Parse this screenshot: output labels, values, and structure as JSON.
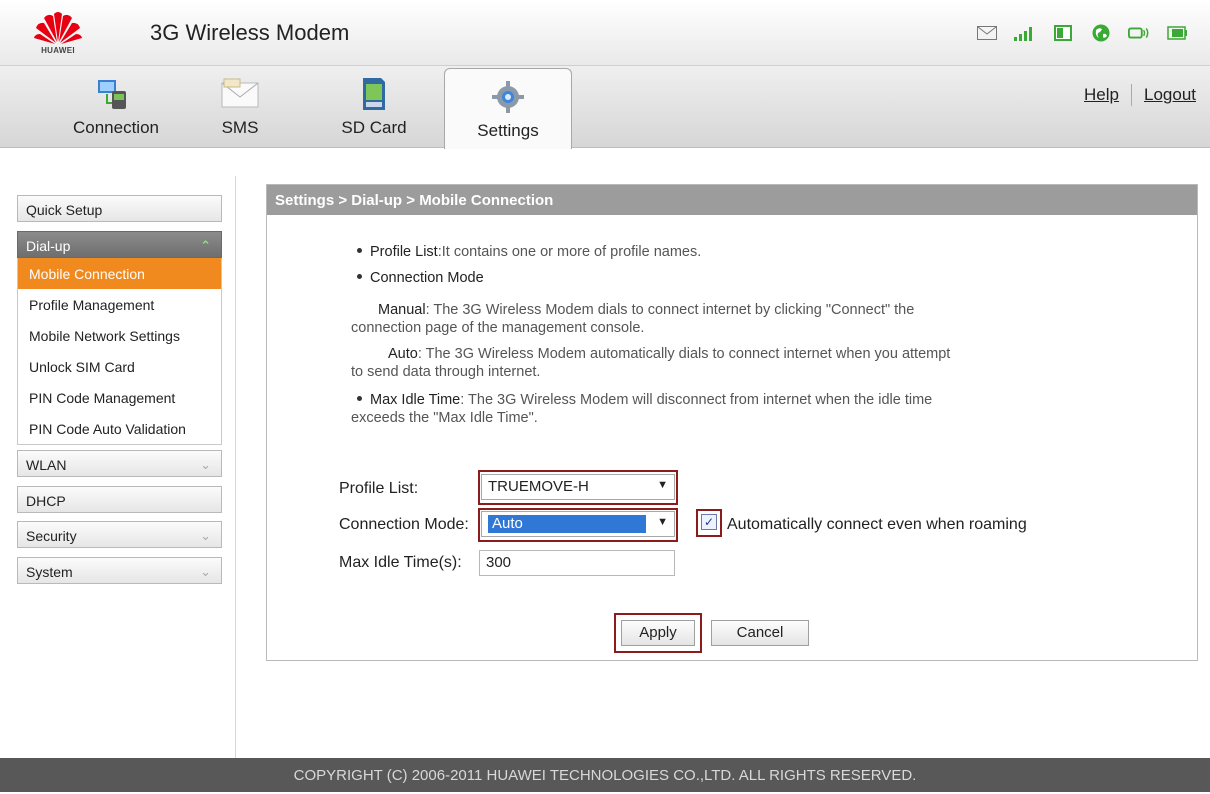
{
  "header": {
    "brand": "HUAWEI",
    "title": "3G Wireless Modem",
    "status_icons": [
      "envelope-icon",
      "signal-bars-icon",
      "sim-icon",
      "globe-icon",
      "wifi-router-icon",
      "battery-icon"
    ]
  },
  "tabs": [
    {
      "label": "Connection",
      "icon": "connection-icon",
      "active": false
    },
    {
      "label": "SMS",
      "icon": "envelope-icon",
      "active": false
    },
    {
      "label": "SD Card",
      "icon": "sd-card-icon",
      "active": false
    },
    {
      "label": "Settings",
      "icon": "gear-icon",
      "active": true
    }
  ],
  "top_links": {
    "help": "Help",
    "logout": "Logout"
  },
  "sidebar": {
    "quick_setup": "Quick Setup",
    "dialup": "Dial-up",
    "dialup_items": [
      "Mobile Connection",
      "Profile Management",
      "Mobile Network Settings",
      "Unlock SIM Card",
      "PIN Code Management",
      "PIN Code Auto Validation"
    ],
    "active_item": "Mobile Connection",
    "wlan": "WLAN",
    "dhcp": "DHCP",
    "security": "Security",
    "system": "System"
  },
  "panel": {
    "breadcrumb": "Settings > Dial-up > Mobile Connection",
    "help": {
      "profile_list_term": "Profile List",
      "profile_list_desc": ":It contains one or more of profile names.",
      "connection_mode_term": "Connection Mode",
      "manual_term": "Manual",
      "manual_desc_1": ": The 3G Wireless Modem dials to connect internet by clicking \"Connect\" the",
      "manual_desc_2": "connection page of the management console.",
      "auto_term": "Auto",
      "auto_desc_1": ": The 3G Wireless Modem automatically dials to connect internet when you attempt",
      "auto_desc_2": "to send data through internet.",
      "idle_term": "Max Idle Time",
      "idle_desc_1": ": The 3G Wireless Modem will disconnect from internet when the idle time",
      "idle_desc_2": "exceeds the \"Max Idle Time\"."
    },
    "form": {
      "profile_label": "Profile List:",
      "profile_value": "TRUEMOVE-H",
      "mode_label": "Connection Mode:",
      "mode_value": "Auto",
      "roaming_checked": true,
      "roaming_label": "Automatically connect even when roaming",
      "idle_label": "Max Idle Time(s):",
      "idle_value": "300",
      "apply": "Apply",
      "cancel": "Cancel"
    }
  },
  "footer": "COPYRIGHT (C) 2006-2011 HUAWEI TECHNOLOGIES CO.,LTD. ALL RIGHTS RESERVED.",
  "colors": {
    "accent": "#f08a1e",
    "panel_header": "#9c9c9c",
    "highlight_box": "#8b1c1c",
    "footer": "#585858"
  }
}
